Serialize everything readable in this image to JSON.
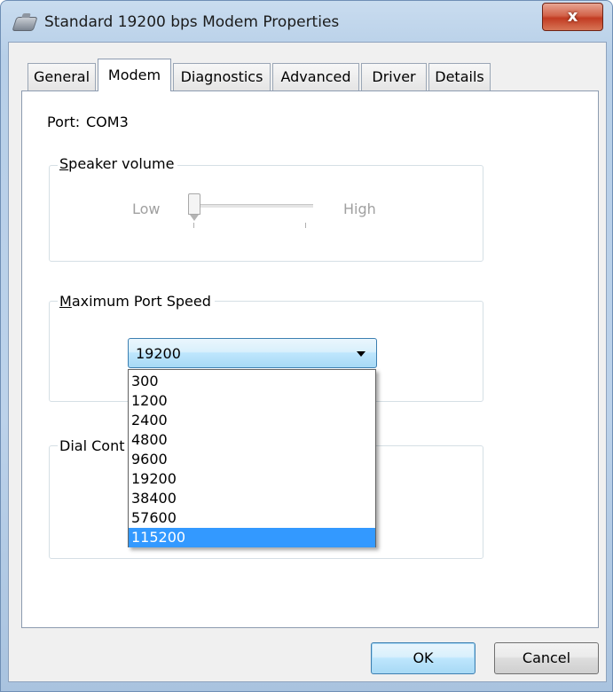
{
  "window": {
    "title": "Standard 19200 bps Modem Properties",
    "close_glyph": "x"
  },
  "tabs": [
    {
      "label": "General",
      "active": false
    },
    {
      "label": "Modem",
      "active": true
    },
    {
      "label": "Diagnostics",
      "active": false
    },
    {
      "label": "Advanced",
      "active": false
    },
    {
      "label": "Driver",
      "active": false
    },
    {
      "label": "Details",
      "active": false
    }
  ],
  "modem": {
    "port_label": "Port:",
    "port_value": "COM3",
    "speaker": {
      "group_title_prefix": "S",
      "group_title_rest": "peaker volume",
      "low_label": "Low",
      "high_label": "High",
      "level": 0
    },
    "port_speed": {
      "group_title_prefix": "M",
      "group_title_rest": "aximum Port Speed",
      "selected": "19200",
      "options": [
        "300",
        "1200",
        "2400",
        "4800",
        "9600",
        "19200",
        "38400",
        "57600",
        "115200"
      ],
      "highlighted": "115200"
    },
    "dial_control": {
      "group_title": "Dial Cont"
    }
  },
  "buttons": {
    "ok": "OK",
    "cancel": "Cancel"
  },
  "colors": {
    "highlight": "#3399ff",
    "close_button": "#c23b22"
  },
  "icons": {
    "window": "modem-icon",
    "dropdown": "chevron-down-icon"
  }
}
